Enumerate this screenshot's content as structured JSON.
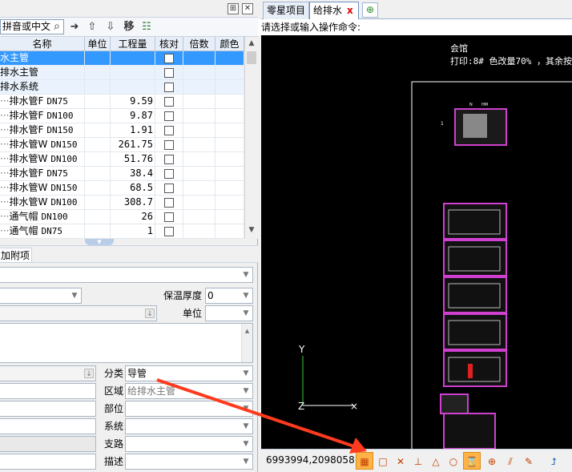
{
  "left_panel": {
    "search": {
      "placeholder": "拼音或中文"
    },
    "titlebar_buttons": [
      "pin",
      "close"
    ],
    "toolbar": {
      "move_label": "移"
    },
    "grid": {
      "columns": [
        "名称",
        "单位",
        "工程量",
        "核对",
        "倍数",
        "颜色"
      ],
      "rows": [
        {
          "name": "水主管",
          "qty": "",
          "level": 0
        },
        {
          "name": "排水主管",
          "qty": "",
          "level": 0
        },
        {
          "name": "排水系统",
          "qty": "",
          "level": 1
        },
        {
          "name": "排水管F",
          "spec": "DN75",
          "qty": "9.59",
          "level": 2
        },
        {
          "name": "排水管F",
          "spec": "DN100",
          "qty": "9.87",
          "level": 2
        },
        {
          "name": "排水管F",
          "spec": "DN150",
          "qty": "1.91",
          "level": 2
        },
        {
          "name": "排水管W",
          "spec": "DN150",
          "qty": "261.75",
          "level": 2
        },
        {
          "name": "排水管W",
          "spec": "DN100",
          "qty": "51.76",
          "level": 2
        },
        {
          "name": "排水管F",
          "spec": "DN75",
          "qty": "38.4",
          "level": 2
        },
        {
          "name": "排水管W",
          "spec": "DN150",
          "qty": "68.5",
          "level": 2
        },
        {
          "name": "排水管W",
          "spec": "DN100",
          "qty": "308.7",
          "level": 2
        },
        {
          "name": "通气帽",
          "spec": "DN100",
          "qty": "26",
          "level": 2
        },
        {
          "name": "通气帽",
          "spec": "DN75",
          "qty": "1",
          "level": 2
        }
      ]
    },
    "attach_tab_label": "加附项",
    "form": {
      "insulation_label": "保温厚度",
      "insulation_value": "0",
      "unit_label": "单位",
      "category_label": "分类",
      "category_value": "导管",
      "region_label": "区域",
      "region_value": "给排水主管",
      "part_label": "部位",
      "system_label": "系统",
      "branch_label": "支路",
      "desc_label": "描述"
    }
  },
  "right_panel": {
    "tabs": [
      {
        "label": "零星项目",
        "active": false
      },
      {
        "label": "给排水",
        "active": true
      }
    ],
    "close_glyph": "x",
    "command_prompt": "请选择或输入操作命令:",
    "drawing": {
      "title": "会馆",
      "print_note": "打印:8# 色改量70% ，其余按",
      "axis_y": "Y",
      "axis_z": "Z",
      "sheet_number": "1",
      "header_n": "N",
      "header_hm": "HM"
    },
    "status": {
      "coordinates": "6993994,2098058",
      "snap_icons": [
        "grid-snap-icon",
        "square-snap-icon",
        "cross-snap-icon",
        "perpendicular-snap-icon",
        "triangle-snap-icon",
        "arc-snap-icon",
        "hourglass-snap-icon",
        "center-snap-icon",
        "parallel-snap-icon",
        "ruler-icon",
        "ucs-icon"
      ]
    }
  },
  "colors": {
    "selection": "#3399ff",
    "drawing_bg": "#000000",
    "sheet_frame": "#d040d0",
    "annotation_arrow": "#ff3b1f",
    "tab_close": "#e00000"
  }
}
